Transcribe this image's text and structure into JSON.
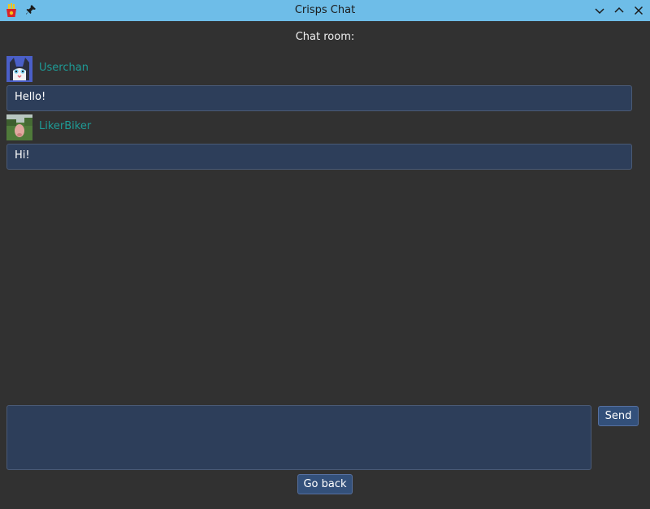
{
  "window": {
    "title": "Crisps Chat",
    "titlebar_color": "#6ebde8",
    "app_icon": "fries-icon",
    "pin_icon": "pin-icon"
  },
  "chat": {
    "room_label": "Chat room:",
    "messages": [
      {
        "user": "Userchan",
        "avatar": "cat-avatar",
        "text": "Hello!"
      },
      {
        "user": "LikerBiker",
        "avatar": "pig-photo-avatar",
        "text": "Hi!"
      }
    ]
  },
  "composer": {
    "value": "",
    "send_label": "Send"
  },
  "footer": {
    "back_label": "Go back"
  },
  "colors": {
    "background": "#313131",
    "username": "#1e9b96",
    "bubble": "#2d3e5a",
    "button": "#33507a"
  }
}
